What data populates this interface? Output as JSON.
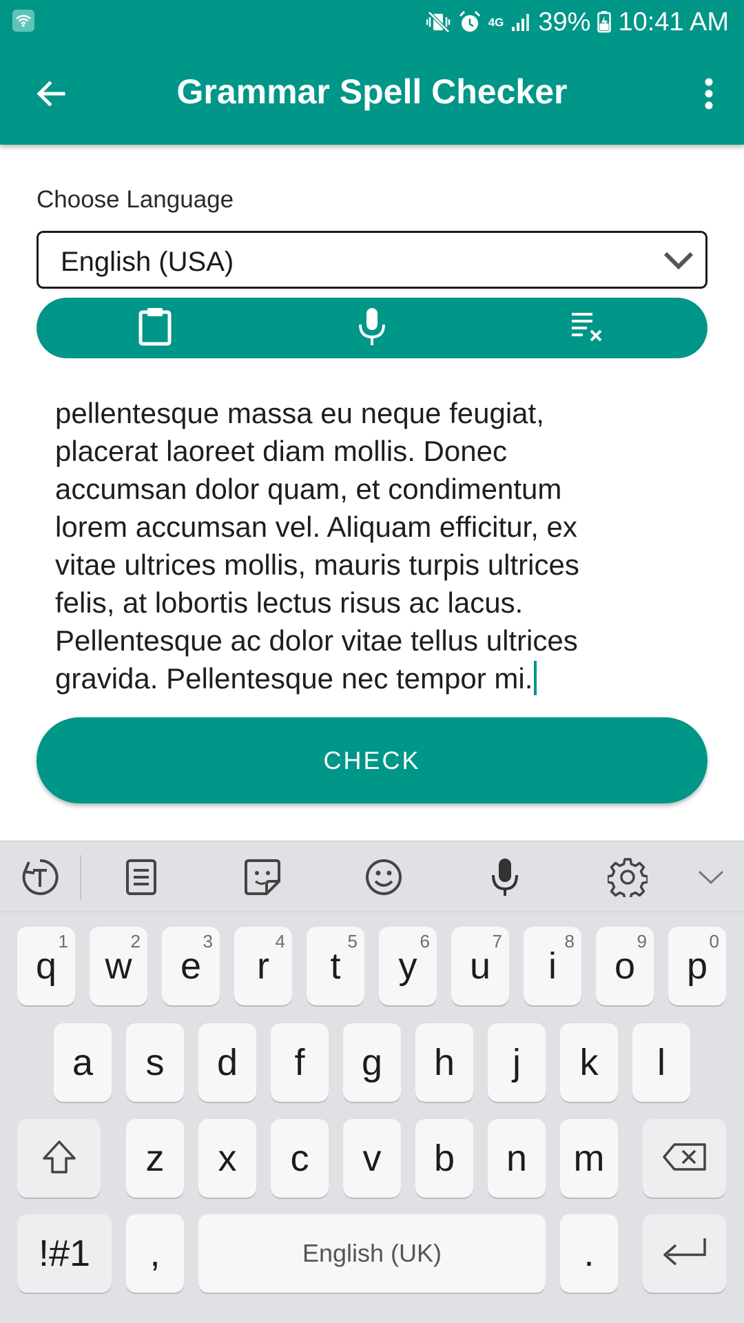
{
  "status_bar": {
    "battery": "39%",
    "time": "10:41 AM",
    "network": "4G",
    "icons": [
      "wifi-icon",
      "mute-vibrate-icon",
      "alarm-icon",
      "signal-icon",
      "battery-icon"
    ]
  },
  "app_bar": {
    "title": "Grammar Spell Checker",
    "icons": [
      "back-arrow-icon",
      "more-vert-icon"
    ]
  },
  "language": {
    "label": "Choose Language",
    "selected": "English (USA)"
  },
  "toolbar": {
    "icons": [
      "clipboard-icon",
      "microphone-icon",
      "clear-text-icon"
    ]
  },
  "editor": {
    "lines": [
      "pellentesque massa eu neque feugiat,",
      "placerat laoreet diam mollis. Donec",
      "accumsan dolor quam, et condimentum",
      "lorem accumsan vel. Aliquam efficitur, ex",
      "vitae ultrices mollis, mauris turpis ultrices",
      "felis, at lobortis lectus risus ac lacus.",
      "Pellentesque ac dolor vitae tellus ultrices",
      "gravida. Pellentesque nec tempor mi."
    ]
  },
  "check_button": {
    "label": "CHECK"
  },
  "keyboard": {
    "toolbar_icons": [
      "text-mode-icon",
      "clipboard-icon",
      "sticker-icon",
      "emoji-icon",
      "voice-input-icon",
      "settings-icon",
      "collapse-icon"
    ],
    "row1": [
      {
        "ch": "q",
        "num": "1"
      },
      {
        "ch": "w",
        "num": "2"
      },
      {
        "ch": "e",
        "num": "3"
      },
      {
        "ch": "r",
        "num": "4"
      },
      {
        "ch": "t",
        "num": "5"
      },
      {
        "ch": "y",
        "num": "6"
      },
      {
        "ch": "u",
        "num": "7"
      },
      {
        "ch": "i",
        "num": "8"
      },
      {
        "ch": "o",
        "num": "9"
      },
      {
        "ch": "p",
        "num": "0"
      }
    ],
    "row2": [
      "a",
      "s",
      "d",
      "f",
      "g",
      "h",
      "j",
      "k",
      "l"
    ],
    "row3": [
      "z",
      "x",
      "c",
      "v",
      "b",
      "n",
      "m"
    ],
    "symbols_label": "!#1",
    "comma": ",",
    "space_label": "English (UK)",
    "period": "."
  },
  "colors": {
    "primary": "#009688",
    "keyboard_bg": "#e0e1e5",
    "key_bg": "#f7f7f7"
  }
}
